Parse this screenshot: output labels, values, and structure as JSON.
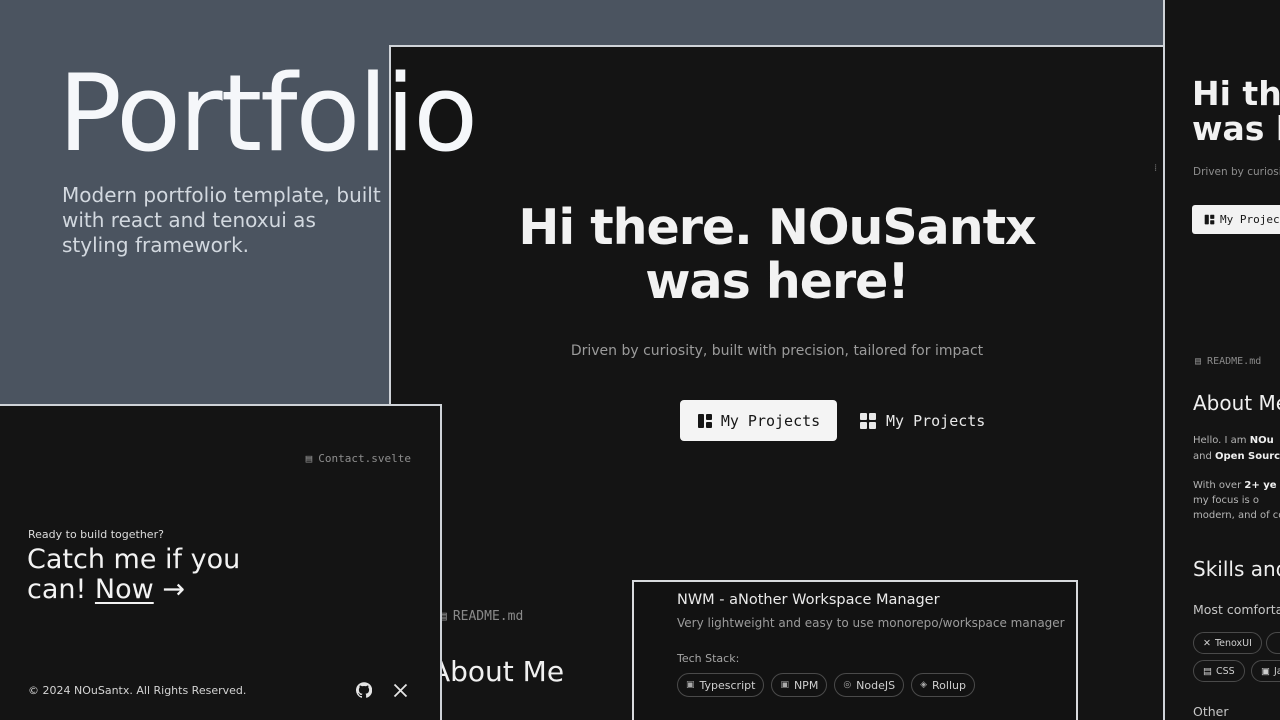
{
  "hero": {
    "title": "Portfolio",
    "description": "Modern portfolio template, built with react and tenoxui as styling framework."
  },
  "main": {
    "heading_line1": "Hi there. NOuSantx",
    "heading_line2": "was here!",
    "subheading": "Driven by curiosity, built with precision, tailored for impact",
    "primary_button": "My Projects",
    "secondary_button": "My Projects",
    "readme_label": "README.md",
    "about_title": "About Me"
  },
  "project": {
    "title": "NWM - aNother Workspace Manager",
    "description": "Very lightweight and easy to use monorepo/workspace manager",
    "stack_label": "Tech Stack:",
    "stack": [
      "Typescript",
      "NPM",
      "NodeJS",
      "Rollup"
    ]
  },
  "contact": {
    "file": "Contact.svelte",
    "kicker": "Ready to build together?",
    "heading": "Catch me if you can!",
    "link": "Now",
    "arrow": "→",
    "footer": "© 2024 NOuSantx. All Rights Reserved."
  },
  "right": {
    "heading_line1": "Hi the",
    "heading_line2": "was h",
    "sub": "Driven by curiosity,",
    "button": "My Projects",
    "readme": "README.md",
    "about": "About Me",
    "p1a_pre": "Hello. I am ",
    "p1a_bold": "NOu",
    "p1b_pre": "and ",
    "p1b_bold": "Open Sourcer",
    "p2a_pre": "With over ",
    "p2a_bold": "2+ ye",
    "p2b": "my focus is o",
    "p2c": "modern, and of cou",
    "skills": "Skills and",
    "comfy": "Most comfortal",
    "chips": [
      "TenoxUI",
      "CSS",
      "Ja"
    ],
    "other": "Other"
  },
  "icons": {
    "primary_button_icon": "layout-icon",
    "secondary_button_icon": "grid-icon",
    "file_icon": "file-icon",
    "github_icon": "github-icon",
    "x_icon": "x-twitter-icon"
  }
}
